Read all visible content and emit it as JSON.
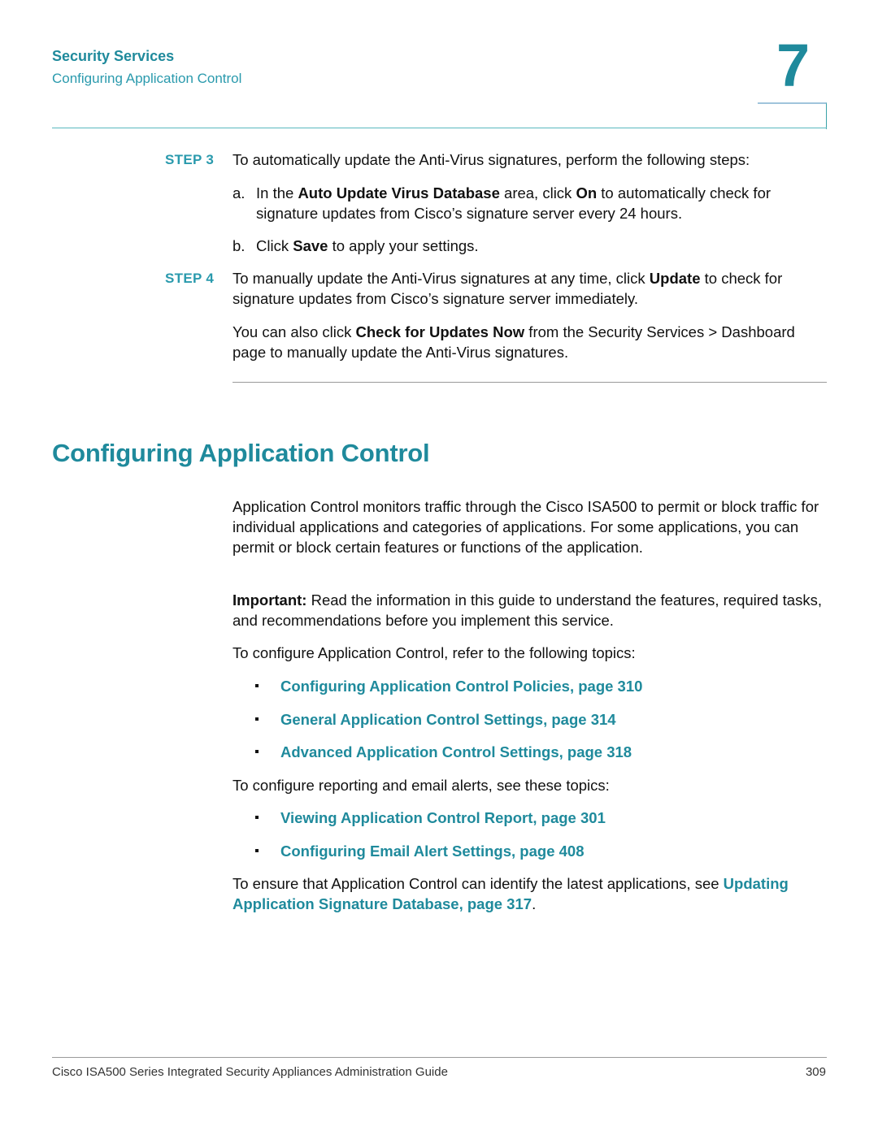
{
  "header": {
    "section": "Security Services",
    "subsection": "Configuring Application Control",
    "chapter_number": "7"
  },
  "steps": [
    {
      "label": "STEP 3",
      "text": "To automatically update the Anti-Virus signatures, perform the following steps:",
      "substeps": [
        {
          "label": "a.",
          "pre": "In the ",
          "bold1": "Auto Update Virus Database",
          "mid": " area, click ",
          "bold2": "On",
          "post": " to automatically check for signature updates from Cisco’s signature server every 24 hours."
        },
        {
          "label": "b.",
          "pre": "Click ",
          "bold1": "Save",
          "post": " to apply your settings."
        }
      ]
    },
    {
      "label": "STEP 4",
      "pre": "To manually update the Anti-Virus signatures at any time, click ",
      "bold": "Update",
      "post": " to check for signature updates from Cisco’s signature server immediately.",
      "note_pre": "You can also click ",
      "note_bold": "Check for Updates Now",
      "note_post": " from the Security Services > Dashboard page to manually update the Anti-Virus signatures."
    }
  ],
  "section": {
    "title": "Configuring Application Control",
    "intro": "Application Control monitors traffic through the Cisco ISA500 to permit or block traffic for individual applications and categories of applications. For some applications, you can permit or block certain features or functions of the application.",
    "important_label": "Important:",
    "important_text": " Read the information in this guide to understand the features, required tasks, and recommendations before you implement this service.",
    "topics_intro": "To configure Application Control, refer to the following topics:",
    "topics": [
      "Configuring Application Control Policies, page 310",
      "General Application Control Settings, page 314",
      "Advanced Application Control Settings, page 318"
    ],
    "reporting_intro": "To configure reporting and email alerts, see these topics:",
    "reporting_topics": [
      "Viewing Application Control Report, page 301",
      "Configuring Email Alert Settings, page 408"
    ],
    "closing_pre": "To ensure that Application Control can identify the latest applications, see ",
    "closing_link": "Updating Application Signature Database, page 317",
    "closing_post": "."
  },
  "footer": {
    "title": "Cisco ISA500 Series Integrated Security Appliances Administration Guide",
    "page": "309"
  },
  "colors": {
    "accent": "#1f8a9c",
    "rule": "#5ab8bf"
  }
}
